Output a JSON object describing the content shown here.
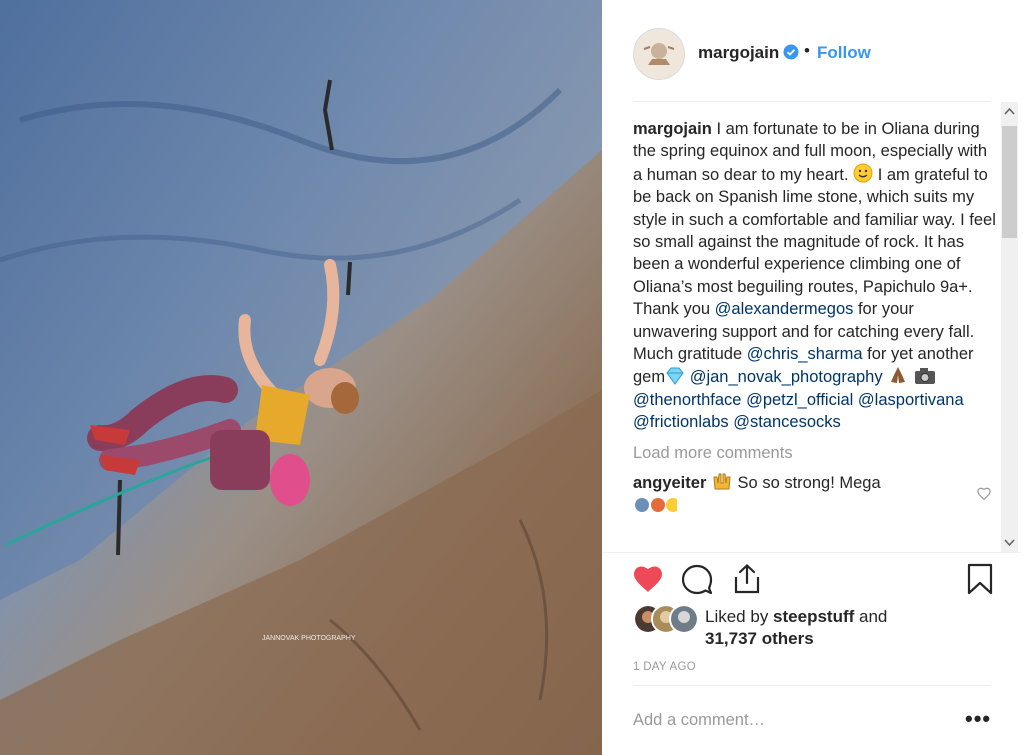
{
  "post": {
    "username": "margojain",
    "dot": "•",
    "follow_label": "Follow",
    "photo_watermark": "JANNOVAK PHOTOGRAPHY"
  },
  "caption": {
    "username": "margojain",
    "text_1": " I am fortunate to be in Oliana during the spring equinox and full moon, especially with a human so dear to my heart. ",
    "text_2": " I am grateful to be back on Spanish lime stone, which suits my style in such a comfortable and familiar way. I feel so small against the magnitude of rock. It has been a wonderful experience climbing one of Oliana’s most beguiling routes, Papichulo 9a+. Thank you ",
    "mention_1": "@alexandermegos",
    "text_3": " for your unwavering support and for catching every fall. Much gratitude ",
    "mention_2": "@chris_sharma",
    "text_4": " for yet another gem",
    "mention_3": "@jan_novak_photography",
    "mention_4": "@thenorthface",
    "mention_5": "@petzl_official",
    "mention_6": "@lasportivana",
    "mention_7": "@frictionlabs",
    "mention_8": "@stancesocks"
  },
  "load_more": "Load more comments",
  "comment_1": {
    "username": "angyeiter",
    "text": " So so strong! Mega"
  },
  "likes": {
    "prefix": "Liked by ",
    "user": "steepstuff",
    "middle": " and",
    "others": "31,737 others"
  },
  "timestamp": "1 DAY AGO",
  "add_comment_placeholder": "Add a comment…",
  "more_label": "•••",
  "colors": {
    "accent": "#3897f0",
    "like_red": "#ed4956",
    "mention": "#003569",
    "muted": "#999999"
  }
}
